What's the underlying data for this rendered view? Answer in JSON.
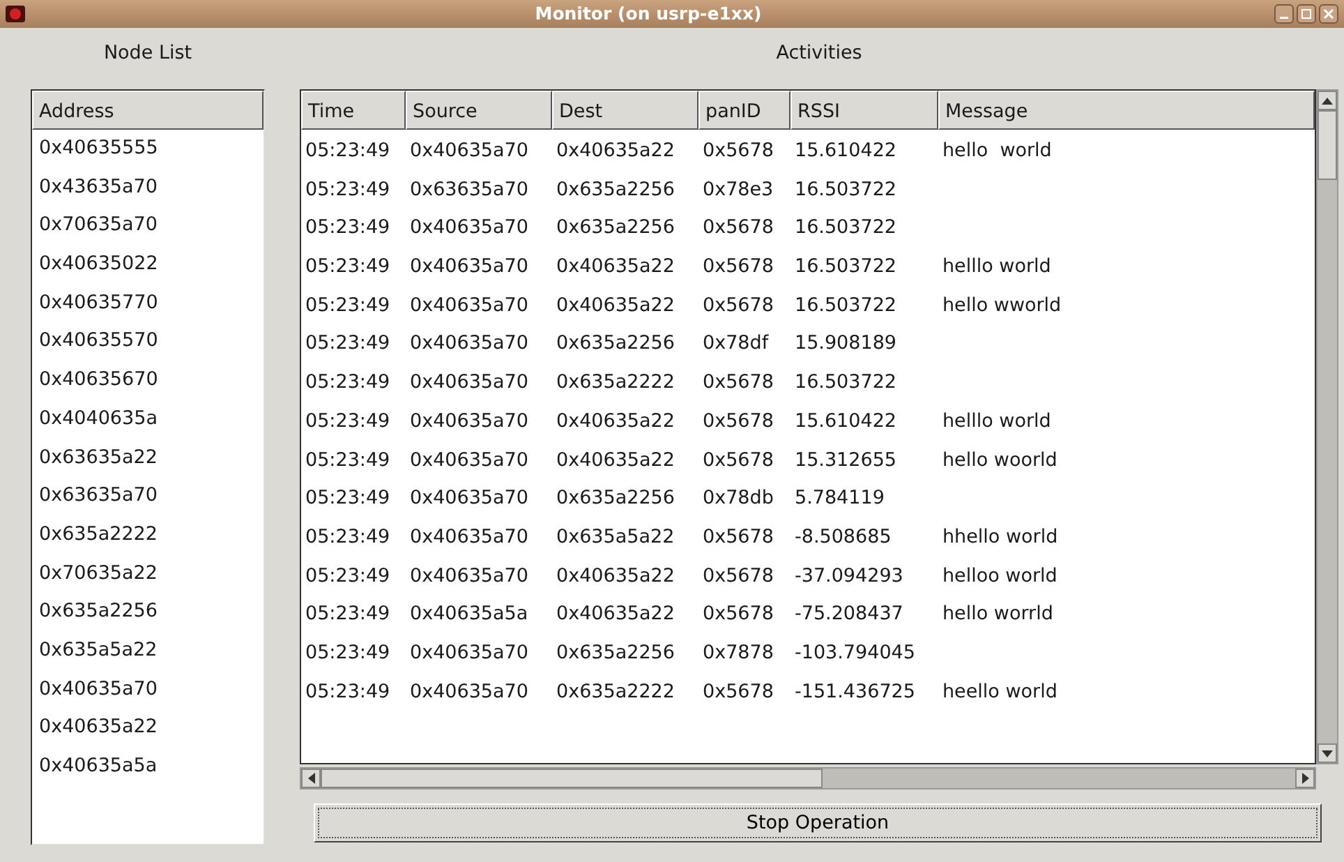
{
  "window": {
    "title": "Monitor (on usrp-e1xx)"
  },
  "node_list": {
    "heading": "Node List",
    "column": "Address",
    "items": [
      "0x40635555",
      "0x43635a70",
      "0x70635a70",
      "0x40635022",
      "0x40635770",
      "0x40635570",
      "0x40635670",
      "0x4040635a",
      "0x63635a22",
      "0x63635a70",
      "0x635a2222",
      "0x70635a22",
      "0x635a2256",
      "0x635a5a22",
      "0x40635a70",
      "0x40635a22",
      "0x40635a5a"
    ]
  },
  "activities": {
    "heading": "Activities",
    "columns": [
      "Time",
      "Source",
      "Dest",
      "panID",
      "RSSI",
      "Message"
    ],
    "rows": [
      [
        "05:23:49",
        "0x40635a70",
        "0x40635a22",
        "0x5678",
        "15.610422",
        "hello  world"
      ],
      [
        "05:23:49",
        "0x63635a70",
        "0x635a2256",
        "0x78e3",
        "16.503722",
        ""
      ],
      [
        "05:23:49",
        "0x40635a70",
        "0x635a2256",
        "0x5678",
        "16.503722",
        ""
      ],
      [
        "05:23:49",
        "0x40635a70",
        "0x40635a22",
        "0x5678",
        "16.503722",
        "helllo world"
      ],
      [
        "05:23:49",
        "0x40635a70",
        "0x40635a22",
        "0x5678",
        "16.503722",
        "hello wworld"
      ],
      [
        "05:23:49",
        "0x40635a70",
        "0x635a2256",
        "0x78df",
        "15.908189",
        ""
      ],
      [
        "05:23:49",
        "0x40635a70",
        "0x635a2222",
        "0x5678",
        "16.503722",
        ""
      ],
      [
        "05:23:49",
        "0x40635a70",
        "0x40635a22",
        "0x5678",
        "15.610422",
        "helllo world"
      ],
      [
        "05:23:49",
        "0x40635a70",
        "0x40635a22",
        "0x5678",
        "15.312655",
        "hello woorld"
      ],
      [
        "05:23:49",
        "0x40635a70",
        "0x635a2256",
        "0x78db",
        "5.784119",
        ""
      ],
      [
        "05:23:49",
        "0x40635a70",
        "0x635a5a22",
        "0x5678",
        "-8.508685",
        "hhello world"
      ],
      [
        "05:23:49",
        "0x40635a70",
        "0x40635a22",
        "0x5678",
        "-37.094293",
        "helloo world"
      ],
      [
        "05:23:49",
        "0x40635a5a",
        "0x40635a22",
        "0x5678",
        "-75.208437",
        "hello worrld"
      ],
      [
        "05:23:49",
        "0x40635a70",
        "0x635a2256",
        "0x7878",
        "-103.794045",
        ""
      ],
      [
        "05:23:49",
        "0x40635a70",
        "0x635a2222",
        "0x5678",
        "-151.436725",
        "heello world"
      ]
    ]
  },
  "stop_button": {
    "label": "Stop Operation"
  }
}
